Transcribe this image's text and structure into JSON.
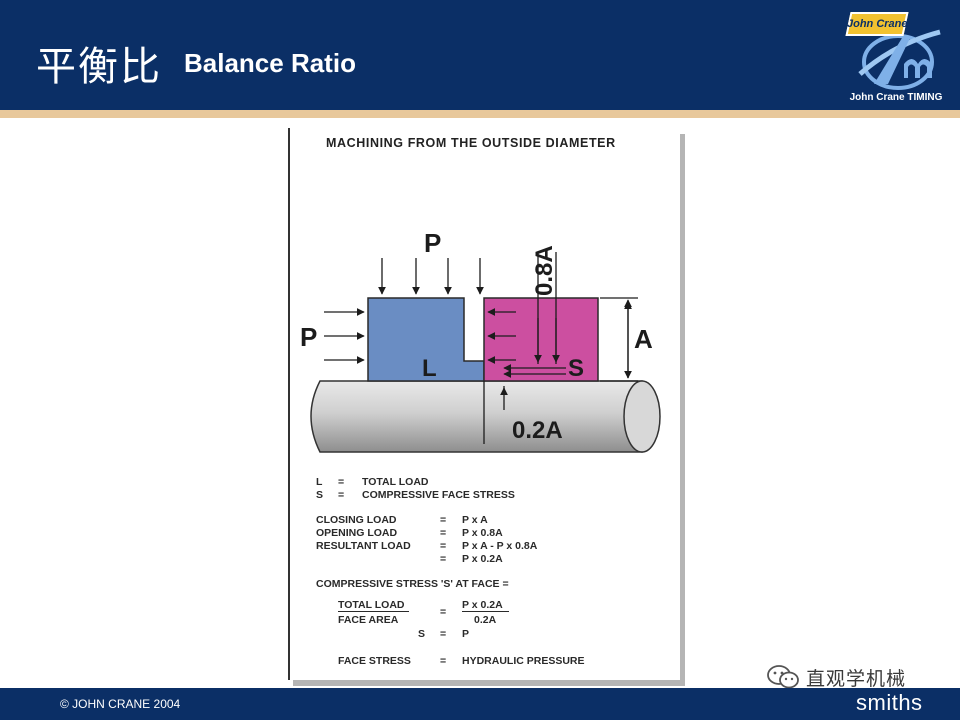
{
  "header": {
    "title_cn": "平衡比",
    "title_en": "Balance Ratio",
    "logo_badge": "John Crane",
    "logo_caption": "John Crane TIMING"
  },
  "diagram": {
    "heading": "MACHINING FROM THE OUTSIDE DIAMETER",
    "labels": {
      "p_top": "P",
      "p_left": "P",
      "l": "L",
      "s": "S",
      "a": "A",
      "a08": "0.8A",
      "a02": "0.2A"
    },
    "colors": {
      "left_block": "#6a8dc3",
      "right_block": "#cc4fa0",
      "shaft": "#c5c5c5"
    },
    "legend": {
      "definitions": [
        {
          "sym": "L",
          "eq": "=",
          "desc": "TOTAL LOAD"
        },
        {
          "sym": "S",
          "eq": "=",
          "desc": "COMPRESSIVE FACE STRESS"
        }
      ],
      "loads": [
        {
          "name": "CLOSING  LOAD",
          "eq": "=",
          "value": "P x A"
        },
        {
          "name": "OPENING LOAD",
          "eq": "=",
          "value": "P x 0.8A"
        },
        {
          "name": "RESULTANT LOAD",
          "eq": "=",
          "value": "P x A - P x 0.8A"
        },
        {
          "name": "",
          "eq": "=",
          "value": "P x 0.2A"
        }
      ],
      "stress_heading": "COMPRESSIVE STRESS 'S' AT FACE =",
      "fraction_left_num": "TOTAL LOAD",
      "fraction_left_den": "FACE AREA",
      "fraction_eq": "=",
      "fraction_right_num": "P x 0.2A",
      "fraction_right_den": "0.2A",
      "s_line": {
        "sym": "S",
        "eq": "=",
        "value": "P"
      },
      "final": {
        "name": "FACE STRESS",
        "eq": "=",
        "value": "HYDRAULIC PRESSURE"
      }
    }
  },
  "watermark": {
    "text": "直观学机械"
  },
  "footer": {
    "copyright": "© JOHN CRANE 2004",
    "brand": "smiths"
  }
}
